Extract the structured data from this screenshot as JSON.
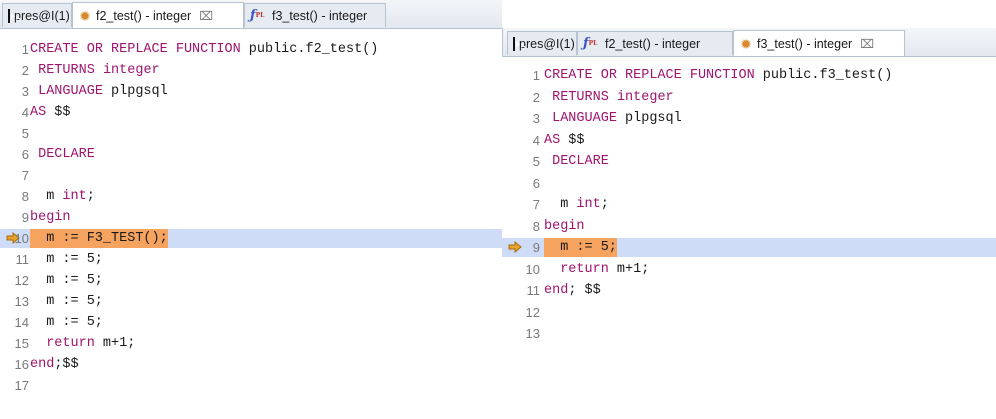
{
  "left_editor": {
    "tabs": [
      {
        "label": "pres@I(1)",
        "icon": "console-icon",
        "active": false
      },
      {
        "label": "f2_test() - integer",
        "icon": "bug-icon",
        "active": true,
        "close": "⌧"
      },
      {
        "label": "f3_test() - integer",
        "icon": "function-icon",
        "active": false
      }
    ],
    "lines": [
      {
        "num": "1",
        "text": "CREATE OR REPLACE FUNCTION public.f2_test()"
      },
      {
        "num": "2",
        "text": " RETURNS integer"
      },
      {
        "num": "3",
        "text": " LANGUAGE plpgsql"
      },
      {
        "num": "4",
        "text": "AS $$"
      },
      {
        "num": "5",
        "text": ""
      },
      {
        "num": "6",
        "text": " DECLARE"
      },
      {
        "num": "7",
        "text": ""
      },
      {
        "num": "8",
        "text": "  m int;"
      },
      {
        "num": "9",
        "text": "begin"
      },
      {
        "num": "10",
        "text": "  m := F3_TEST();",
        "current": true
      },
      {
        "num": "11",
        "text": "  m := 5;"
      },
      {
        "num": "12",
        "text": "  m := 5;"
      },
      {
        "num": "13",
        "text": "  m := 5;"
      },
      {
        "num": "14",
        "text": "  m := 5;"
      },
      {
        "num": "15",
        "text": "  return m+1;"
      },
      {
        "num": "16",
        "text": "end;$$"
      },
      {
        "num": "17",
        "text": ""
      }
    ]
  },
  "right_editor": {
    "tabs": [
      {
        "label": "pres@I(1)",
        "icon": "console-icon",
        "active": false
      },
      {
        "label": "f2_test() - integer",
        "icon": "function-icon",
        "active": false
      },
      {
        "label": "f3_test() - integer",
        "icon": "bug-icon",
        "active": true,
        "close": "⌧"
      }
    ],
    "lines": [
      {
        "num": "1",
        "text": "CREATE OR REPLACE FUNCTION public.f3_test()"
      },
      {
        "num": "2",
        "text": " RETURNS integer"
      },
      {
        "num": "3",
        "text": " LANGUAGE plpgsql"
      },
      {
        "num": "4",
        "text": "AS $$"
      },
      {
        "num": "5",
        "text": " DECLARE"
      },
      {
        "num": "6",
        "text": ""
      },
      {
        "num": "7",
        "text": "  m int;"
      },
      {
        "num": "8",
        "text": "begin"
      },
      {
        "num": "9",
        "text": "  m := 5;",
        "current": true
      },
      {
        "num": "10",
        "text": "  return m+1;"
      },
      {
        "num": "11",
        "text": "end; $$"
      },
      {
        "num": "12",
        "text": ""
      },
      {
        "num": "13",
        "text": ""
      }
    ]
  },
  "colors": {
    "keyword": "#a0136f",
    "current_line": "#cfdcf8",
    "current_code": "#f5a35e",
    "arrow": "#e8a32a"
  },
  "keywords": [
    "CREATE",
    "OR",
    "REPLACE",
    "FUNCTION",
    "RETURNS",
    "integer",
    "LANGUAGE",
    "AS",
    "DECLARE",
    "int",
    "begin",
    "return",
    "end"
  ]
}
